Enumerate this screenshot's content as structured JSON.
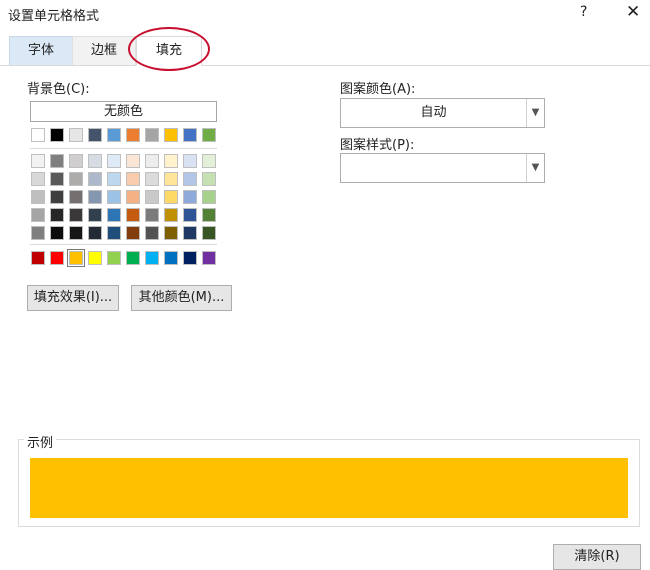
{
  "window": {
    "title": "设置单元格格式",
    "help": "?",
    "close": "✕"
  },
  "tabs": [
    "字体",
    "边框",
    "填充"
  ],
  "background": {
    "label": "背景色(C):",
    "no_color": "无颜色",
    "theme_row": [
      "#ffffff",
      "#000000",
      "#e7e6e6",
      "#44546a",
      "#5b9bd5",
      "#ed7d31",
      "#a5a5a5",
      "#ffc000",
      "#4472c4",
      "#70ad47"
    ],
    "tints": [
      [
        "#f2f2f2",
        "#7f7f7f",
        "#d0cece",
        "#d6dce4",
        "#deebf6",
        "#fbe5d5",
        "#ededed",
        "#fff2cc",
        "#d9e2f3",
        "#e2efd9"
      ],
      [
        "#d8d8d8",
        "#595959",
        "#aeabab",
        "#adb9ca",
        "#bdd7ee",
        "#f7cbac",
        "#dbdbdb",
        "#fee599",
        "#b4c6e7",
        "#c5e0b3"
      ],
      [
        "#bfbfbf",
        "#3f3f3f",
        "#757070",
        "#8496b0",
        "#9cc3e5",
        "#f4b183",
        "#c9c9c9",
        "#ffd965",
        "#8eaadb",
        "#a8d08d"
      ],
      [
        "#a5a5a5",
        "#262626",
        "#3a3838",
        "#323f4f",
        "#2e75b5",
        "#c55a11",
        "#7b7b7b",
        "#bf9000",
        "#2f5496",
        "#538135"
      ],
      [
        "#7f7f7f",
        "#0c0c0c",
        "#171616",
        "#222a35",
        "#1e4e79",
        "#833c0b",
        "#525252",
        "#7f6000",
        "#1f3864",
        "#375623"
      ]
    ],
    "standard": [
      "#c00000",
      "#ff0000",
      "#ffc000",
      "#ffff00",
      "#92d050",
      "#00b050",
      "#00b0f0",
      "#0070c0",
      "#002060",
      "#7030a0"
    ],
    "fill_effects_button": "填充效果(I)...",
    "more_colors_button": "其他颜色(M)..."
  },
  "pattern": {
    "color_label": "图案颜色(A):",
    "color_value": "自动",
    "style_label": "图案样式(P):",
    "style_value": ""
  },
  "sample": {
    "label": "示例",
    "color": "#ffc000"
  },
  "clear_button": "清除(R)"
}
